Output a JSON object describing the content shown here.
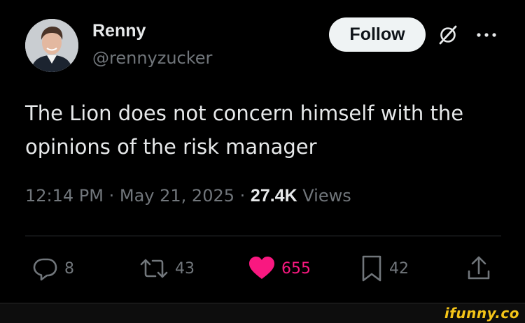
{
  "author": {
    "name": "Renny",
    "handle": "@rennyzucker",
    "avatar_icon": "profile-photo"
  },
  "header": {
    "follow_label": "Follow",
    "grok_icon": "grok-icon",
    "more_icon": "more-horizontal-icon"
  },
  "tweet": {
    "text": "The Lion does not concern himself with the opinions of the risk manager",
    "time": "12:14 PM",
    "date": "May 21, 2025",
    "views_count": "27.4K",
    "views_label": "Views"
  },
  "actions": {
    "replies": "8",
    "reposts": "43",
    "likes": "655",
    "bookmarks": "42"
  },
  "colors": {
    "background": "#000000",
    "text": "#e7e9ea",
    "muted": "#71767b",
    "like": "#f91880",
    "watermark": "#f5c518"
  },
  "watermark": {
    "text": "ifunny.co"
  }
}
